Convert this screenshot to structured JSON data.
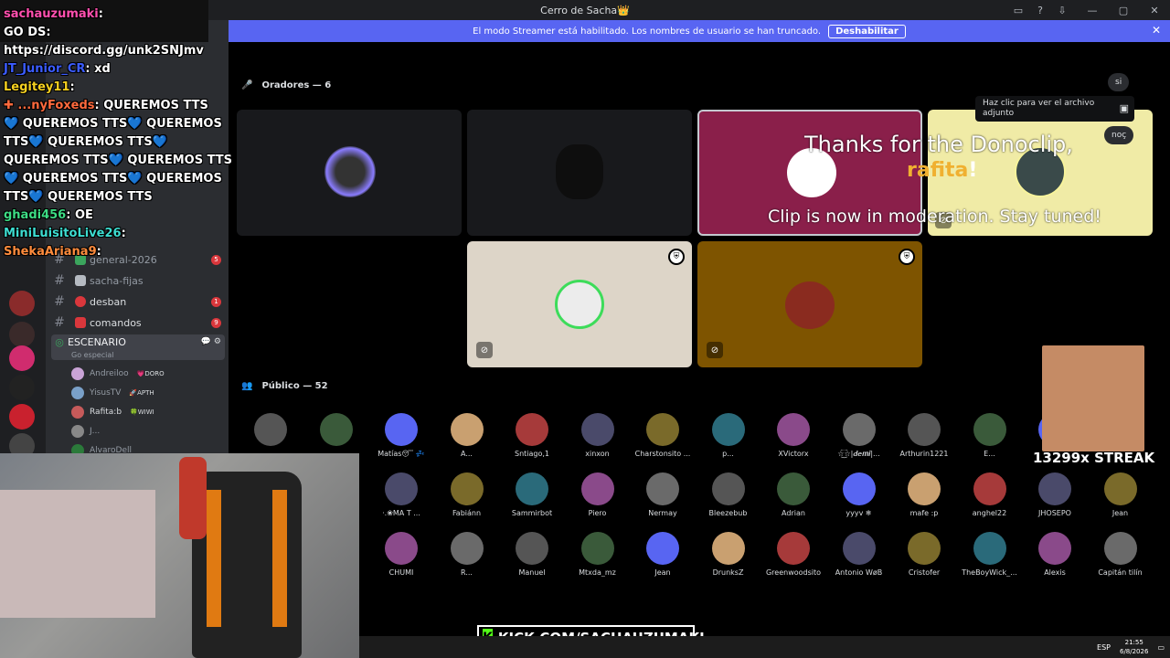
{
  "window": {
    "title": "Cerro de Sacha👑",
    "controls": [
      "—",
      "▢",
      "✕"
    ]
  },
  "banner": {
    "text": "El modo Streamer está habilitado. Los nombres de usuario se han truncado.",
    "button": "Deshabilitar"
  },
  "sidebar": {
    "channels": [
      {
        "name": "general-2026",
        "badge": "5",
        "emoji_color": "#3ba55d"
      },
      {
        "name": "sacha-fijas",
        "badge": "",
        "emoji_color": "#b5bac1"
      },
      {
        "name": "desban",
        "badge": "1",
        "emoji_color": "#da373c"
      },
      {
        "name": "comandos",
        "badge": "9",
        "emoji_color": "#da373c"
      }
    ],
    "stage": {
      "name": "ESCENARIO",
      "sub": "Go especial"
    },
    "members": [
      {
        "name": "Andreiloo",
        "tag": "💗DORO",
        "color": "#c9a3d6"
      },
      {
        "name": "YisusTV",
        "tag": "🚀APTH",
        "color": "#7aa0c8"
      },
      {
        "name": "Rafita:b",
        "tag": "🍀WIWI",
        "color": "#c65a5a"
      },
      {
        "name": "J...",
        "tag": "",
        "color": "#888"
      },
      {
        "name": "AlvaroDell",
        "tag": "",
        "color": "#2b7a3a"
      }
    ]
  },
  "main": {
    "speakers_head": "Oradores — 6",
    "audience_head": "Público — 52",
    "donation": {
      "line1": "Thanks for the Donoclip,",
      "name": "rafita",
      "bang": "!",
      "line2": "Clip is now in moderation. Stay tuned!"
    },
    "tooltip": "Haz clic para ver el archivo adjunto",
    "pills": [
      "si",
      "noç"
    ],
    "audience": [
      [
        "",
        "",
        "Matías😴 💤",
        "A...",
        "Sntiago,1",
        "xinxon",
        "Charstonsito ...",
        "p...",
        "XVictorx",
        "☆͜͡☆|𝒅𝒆𝒎𝒊|...",
        "Arthurin1221",
        "E...",
        ""
      ],
      [
        "",
        "",
        "·.❀MA T ...",
        "Fabiánn",
        "Sammirbot",
        "Piero",
        "Nermay",
        "Bleezebub",
        "Adrian",
        "yyyv ❄",
        "mafe :p",
        "anghel22",
        "JHOSEPO",
        "Jean"
      ],
      [
        "",
        "",
        "CHUMI",
        "R...",
        "Manuel",
        "Mtxda_mz",
        "Jean",
        "DrunksZ",
        "Greenwoodsito",
        "Antonio WøB",
        "Cristofer",
        "TheBoyWick_...",
        "Alexis",
        "Capitán tilín"
      ]
    ]
  },
  "chat": {
    "lines": [
      {
        "user": "sachauzumaki",
        "text": ":",
        "color": "#ff4fae"
      },
      {
        "user": "",
        "text": "GO DS:",
        "color": "#fff"
      },
      {
        "user": "",
        "text": "https://discord.gg/unk2SNJmv",
        "color": "#fff"
      },
      {
        "user": "JT_Junior_CR",
        "text": ": xd",
        "color": "#3b5cff"
      },
      {
        "user": "Legitey11",
        "text": ":",
        "color": "#f5d020"
      },
      {
        "user": "✚ ...nyFoxeds",
        "text": ": QUEREMOS TTS",
        "color": "#ff6a3d"
      },
      {
        "user": "",
        "text": "💙 QUEREMOS TTS💙 QUEREMOS",
        "color": "#fff"
      },
      {
        "user": "",
        "text": "TTS💙 QUEREMOS TTS💙",
        "color": "#fff"
      },
      {
        "user": "",
        "text": "QUEREMOS TTS💙 QUEREMOS TTS",
        "color": "#fff"
      },
      {
        "user": "",
        "text": "💙 QUEREMOS TTS💙 QUEREMOS",
        "color": "#fff"
      },
      {
        "user": "",
        "text": "TTS💙 QUEREMOS TTS",
        "color": "#fff"
      },
      {
        "user": "ghadi456",
        "text": ": OE",
        "color": "#3ddc84"
      },
      {
        "user": "MiniLuisitoLive26",
        "text": ":",
        "color": "#3ddcd0"
      },
      {
        "user": "ShekaAriana9",
        "text": ":",
        "color": "#ff8c3d"
      }
    ]
  },
  "overlays": {
    "kick": "KICK.COM/SACHAUZUMAKI",
    "streak": "13299x STREAK"
  },
  "taskbar": {
    "lang": "ESP",
    "time": "21:55",
    "date": "6/8/2026"
  }
}
